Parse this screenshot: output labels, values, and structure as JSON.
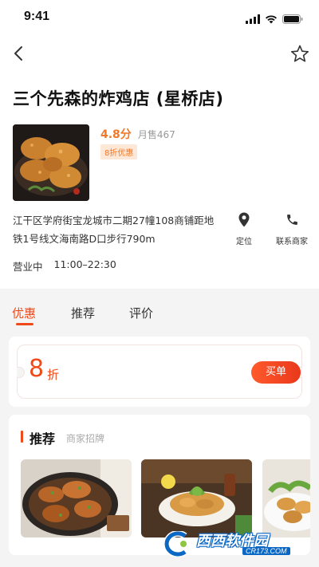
{
  "status_bar": {
    "time": "9:41"
  },
  "shop": {
    "name": "三个先森的炸鸡店 (星桥店)",
    "rating": "4.8分",
    "monthly_sales": "月售467",
    "discount_tag": "8折优惠",
    "address": "江干区学府街宝龙城市二期27幢108商铺距地铁1号线文海南路D口步行790m",
    "locate_label": "定位",
    "contact_label": "联系商家",
    "status": "营业中",
    "hours": "11:00–22:30"
  },
  "tabs": [
    {
      "label": "优惠",
      "active": true
    },
    {
      "label": "推荐",
      "active": false
    },
    {
      "label": "评价",
      "active": false
    }
  ],
  "coupon": {
    "number": "8",
    "unit": "折",
    "buy_label": "买单"
  },
  "recommend": {
    "title": "推荐",
    "subtitle": "商家招牌"
  },
  "watermark": {
    "brand": "西西软件园",
    "url": "CR173.COM"
  },
  "colors": {
    "accent": "#f04a1a",
    "rating": "#f07826"
  },
  "icons": [
    "back-icon",
    "star-icon",
    "location-pin-icon",
    "phone-icon",
    "signal-icon",
    "wifi-icon",
    "battery-icon"
  ]
}
